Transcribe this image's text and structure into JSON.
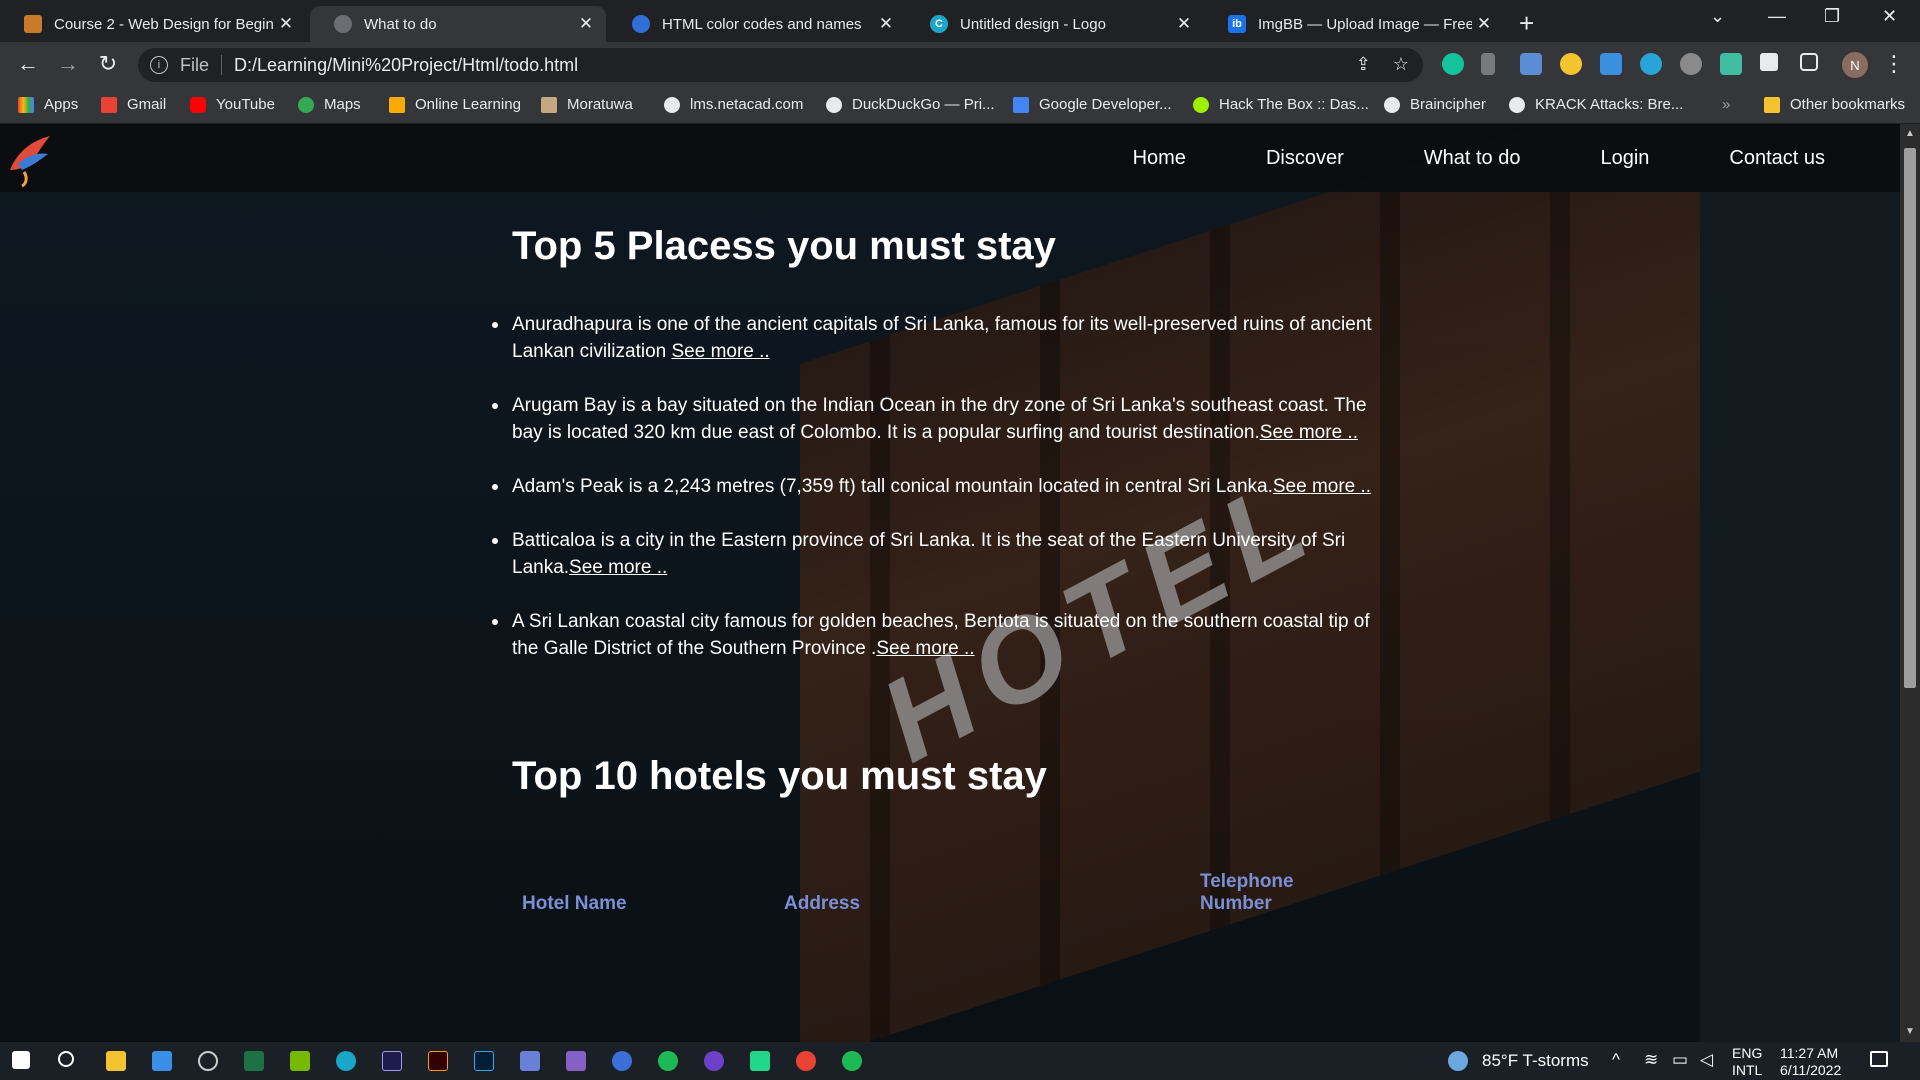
{
  "browser": {
    "tabs": [
      {
        "title": "Course 2 - Web Design for Begin",
        "color": "#c97a2a"
      },
      {
        "title": "What to do",
        "color": "#6b6f75"
      },
      {
        "title": "HTML color codes and names",
        "color": "#2f6fd6"
      },
      {
        "title": "Untitled design - Logo",
        "color": "#1aa5c9"
      },
      {
        "title": "ImgBB — Upload Image — Free",
        "color": "#1a73e8"
      }
    ],
    "url_scheme": "File",
    "url": "D:/Learning/Mini%20Project/Html/todo.html",
    "avatar_letter": "N",
    "bookmarks": [
      {
        "label": "Apps",
        "color": "#ea4335"
      },
      {
        "label": "Gmail",
        "color": "#ea4335"
      },
      {
        "label": "YouTube",
        "color": "#ff0000"
      },
      {
        "label": "Maps",
        "color": "#34a853"
      },
      {
        "label": "Online Learning",
        "color": "#f9ab00"
      },
      {
        "label": "Moratuwa",
        "color": "#c5a880"
      },
      {
        "label": "lms.netacad.com",
        "color": "#e8eaed"
      },
      {
        "label": "DuckDuckGo — Pri...",
        "color": "#e8eaed"
      },
      {
        "label": "Google Developer...",
        "color": "#4285f4"
      },
      {
        "label": "Hack The Box :: Das...",
        "color": "#9fef00"
      },
      {
        "label": "Braincipher",
        "color": "#e8eaed"
      },
      {
        "label": "KRACK Attacks: Bre...",
        "color": "#e8eaed"
      }
    ],
    "overflow_label": "»",
    "other_bookmarks": "Other bookmarks"
  },
  "site": {
    "nav": [
      "Home",
      "Discover",
      "What to do",
      "Login",
      "Contact us"
    ],
    "sign_text": "HOTEL",
    "heading1": "Top 5 Placess you must stay",
    "places": [
      {
        "text": "Anuradhapura is one of the ancient capitals of Sri Lanka, famous for its well-preserved ruins of ancient Lankan civilization ",
        "link": "See more .."
      },
      {
        "text": "Arugam Bay is a bay situated on the Indian Ocean in the dry zone of Sri Lanka's southeast coast. The bay is located 320 km due east of Colombo. It is a popular surfing and tourist destination.",
        "link": "See more .."
      },
      {
        "text": "Adam's Peak is a 2,243 metres (7,359 ft) tall conical mountain located in central Sri Lanka.",
        "link": "See more .."
      },
      {
        "text": "Batticaloa is a city in the Eastern province of Sri Lanka. It is the seat of the Eastern University of Sri Lanka.",
        "link": "See more .."
      },
      {
        "text": "A Sri Lankan coastal city famous for golden beaches, Bentota is situated on the southern coastal tip of the Galle District of the Southern Province .",
        "link": "See more .."
      }
    ],
    "heading2": "Top 10 hotels you must stay",
    "table_headers": [
      "Hotel Name",
      "Address",
      "Telephone Number"
    ]
  },
  "taskbar": {
    "weather": "85°F  T-storms",
    "lang": "ENG",
    "layout": "INTL",
    "time": "11:27 AM",
    "date": "6/11/2022"
  }
}
